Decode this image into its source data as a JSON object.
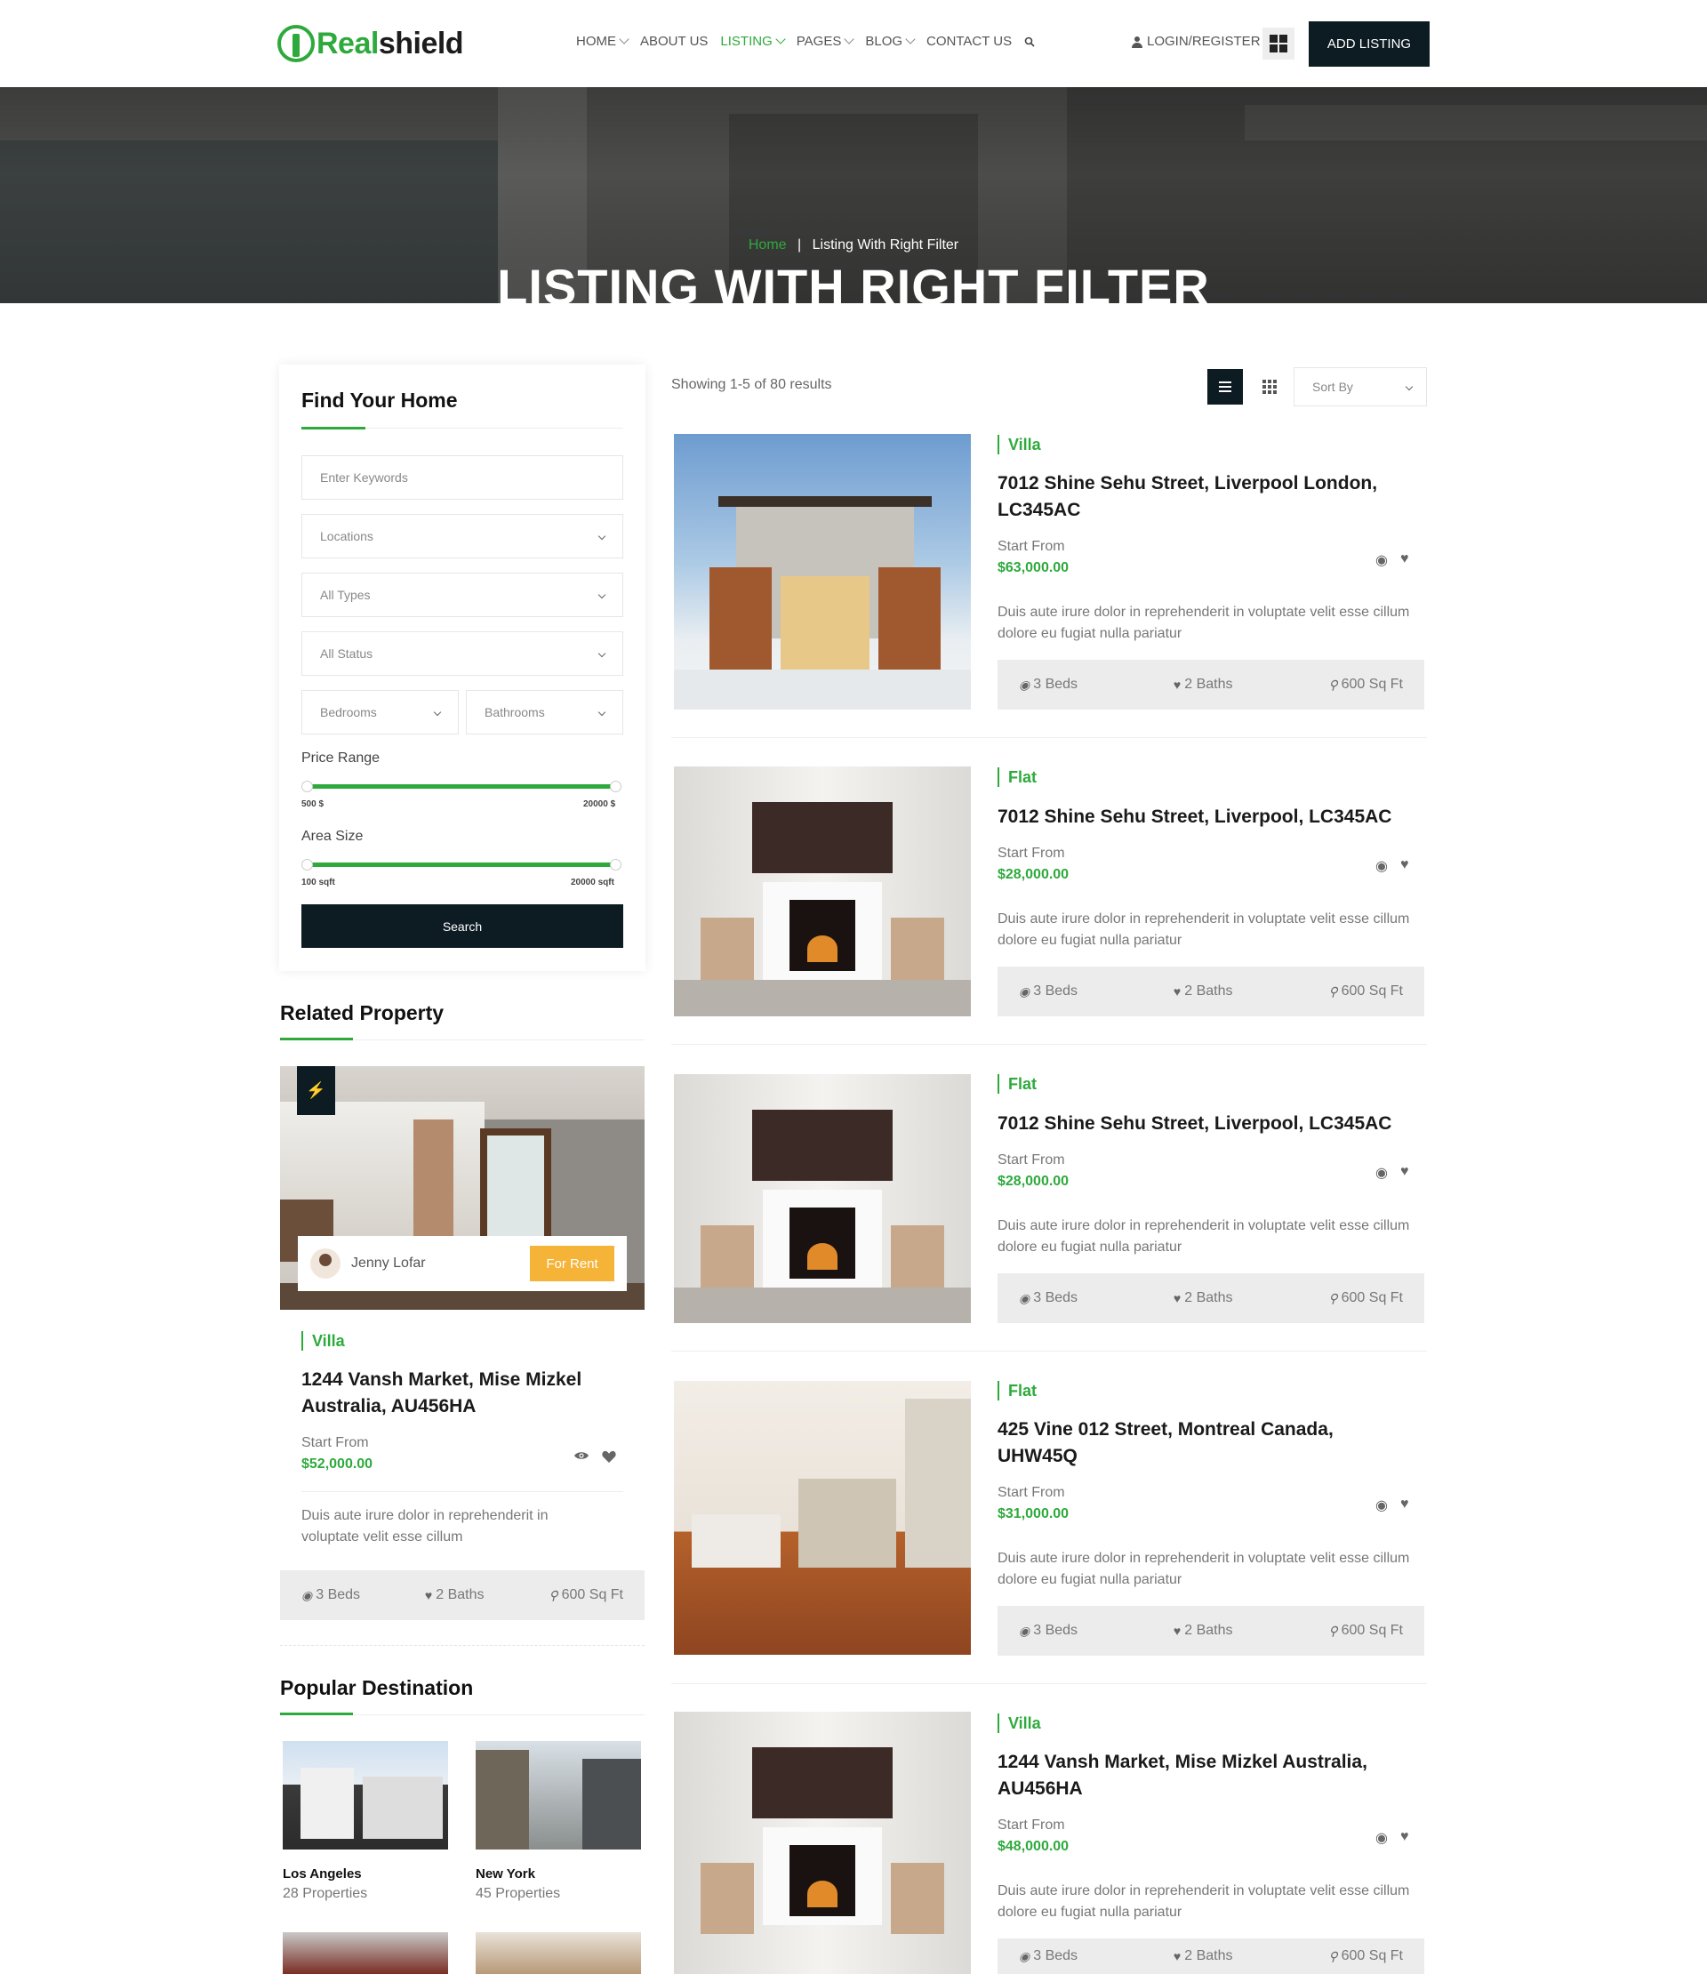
{
  "header": {
    "logo_a": "Real",
    "logo_b": "shield",
    "nav": [
      "HOME",
      "ABOUT US",
      "LISTING",
      "PAGES",
      "BLOG",
      "CONTACT US"
    ],
    "login": "LOGIN/REGISTER",
    "add_listing": "ADD LISTING"
  },
  "hero": {
    "breadcrumb_home": "Home",
    "breadcrumb_current": "Listing With Right Filter",
    "title": "LISTING WITH RIGHT FILTER"
  },
  "filter": {
    "title": "Find Your Home",
    "keywords_placeholder": "Enter Keywords",
    "locations": "Locations",
    "types": "All Types",
    "status": "All Status",
    "bedrooms": "Bedrooms",
    "bathrooms": "Bathrooms",
    "price_label": "Price Range",
    "price_min": "500 $",
    "price_max": "20000 $",
    "area_label": "Area Size",
    "area_min": "100 sqft",
    "area_max": "20000 sqft",
    "search": "Search"
  },
  "related": {
    "title": "Related Property",
    "agent": "Jenny Lofar",
    "badge": "For Rent",
    "type": "Villa",
    "address": "1244 Vansh Market, Mise Mizkel Australia, AU456HA",
    "start_from": "Start From",
    "price": "$52,000.00",
    "desc": "Duis aute irure dolor in reprehenderit in voluptate velit esse cillum",
    "beds": "3 Beds",
    "baths": "2 Baths",
    "area": "600 Sq Ft"
  },
  "popular": {
    "title": "Popular Destination",
    "items": [
      {
        "name": "Los Angeles",
        "count": "28 Properties"
      },
      {
        "name": "New York",
        "count": "45 Properties"
      }
    ]
  },
  "listing": {
    "showing": "Showing 1-5 of 80 results",
    "sort": "Sort By",
    "start_from": "Start From",
    "items": [
      {
        "type": "Villa",
        "address": "7012 Shine Sehu Street, Liverpool London, LC345AC",
        "price": "$63,000.00",
        "desc": "Duis aute irure dolor in reprehenderit in voluptate velit esse cillum dolore eu fugiat nulla pariatur",
        "beds": "3 Beds",
        "baths": "2 Baths",
        "area": "600 Sq Ft"
      },
      {
        "type": "Flat",
        "address": "7012 Shine Sehu Street, Liverpool, LC345AC",
        "price": "$28,000.00",
        "desc": "Duis aute irure dolor in reprehenderit in voluptate velit esse cillum dolore eu fugiat nulla pariatur",
        "beds": "3 Beds",
        "baths": "2 Baths",
        "area": "600 Sq Ft"
      },
      {
        "type": "Flat",
        "address": "7012 Shine Sehu Street, Liverpool, LC345AC",
        "price": "$28,000.00",
        "desc": "Duis aute irure dolor in reprehenderit in voluptate velit esse cillum dolore eu fugiat nulla pariatur",
        "beds": "3 Beds",
        "baths": "2 Baths",
        "area": "600 Sq Ft"
      },
      {
        "type": "Flat",
        "address": "425 Vine 012 Street, Montreal Canada, UHW45Q",
        "price": "$31,000.00",
        "desc": "Duis aute irure dolor in reprehenderit in voluptate velit esse cillum dolore eu fugiat nulla pariatur",
        "beds": "3 Beds",
        "baths": "2 Baths",
        "area": "600 Sq Ft"
      },
      {
        "type": "Villa",
        "address": "1244 Vansh Market, Mise Mizkel Australia, AU456HA",
        "price": "$48,000.00",
        "desc": "Duis aute irure dolor in reprehenderit in voluptate velit esse cillum dolore eu fugiat nulla pariatur",
        "beds": "3 Beds",
        "baths": "2 Baths",
        "area": "600 Sq Ft"
      }
    ]
  },
  "colors": {
    "accent": "#2eaa3c",
    "dark": "#0d1b22",
    "badge": "#f5b338"
  }
}
